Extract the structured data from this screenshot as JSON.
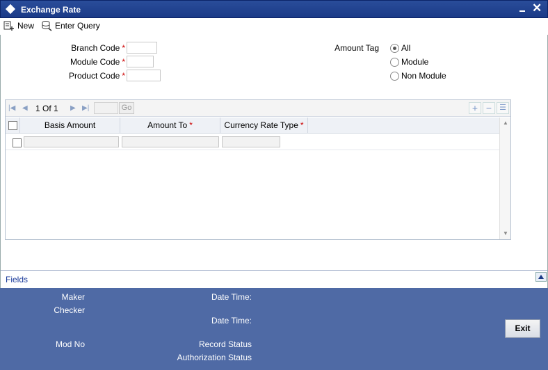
{
  "window": {
    "title": "Exchange Rate"
  },
  "toolbar": {
    "new_label": "New",
    "enter_query_label": "Enter Query"
  },
  "form": {
    "branch_code_label": "Branch Code",
    "module_code_label": "Module Code",
    "product_code_label": "Product Code",
    "required_mark": "*",
    "amount_tag_label": "Amount Tag",
    "amount_tag_options": [
      "All",
      "Module",
      "Non Module"
    ],
    "amount_tag_selected": "All"
  },
  "grid": {
    "pager_text": "1 Of 1",
    "go_label": "Go",
    "columns": [
      "Basis Amount",
      "Amount To",
      "Currency Rate Type"
    ],
    "required_columns": [
      "Amount To",
      "Currency Rate Type"
    ]
  },
  "fields_bar": {
    "label": "Fields"
  },
  "footer": {
    "maker_label": "Maker",
    "checker_label": "Checker",
    "date_time_label": "Date Time:",
    "mod_no_label": "Mod No",
    "record_status_label": "Record Status",
    "authorization_status_label": "Authorization Status",
    "exit_label": "Exit"
  },
  "colors": {
    "title_bar": "#1a3a87",
    "footer_bg": "#4f6aa5",
    "required": "#cc0000"
  }
}
